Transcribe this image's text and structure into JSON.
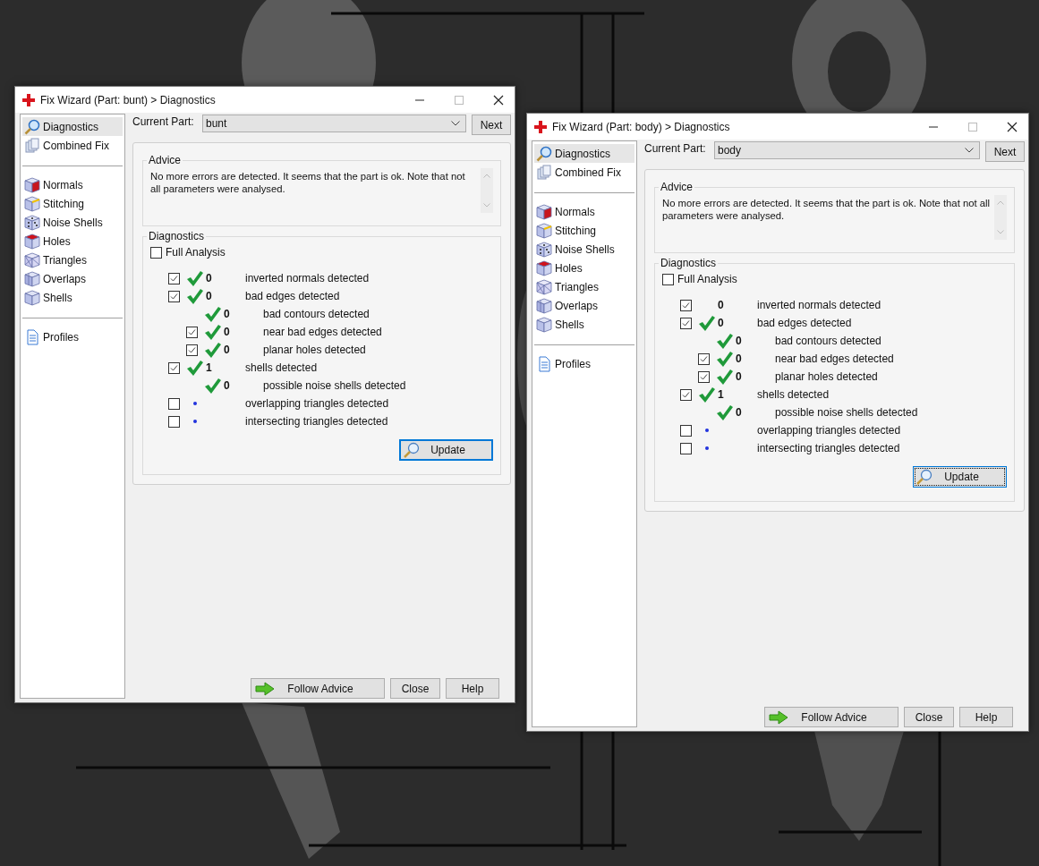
{
  "windows": [
    {
      "title": "Fix Wizard (Part: bunt) > Diagnostics",
      "sidebar": {
        "groups": [
          [
            {
              "label": "Diagnostics",
              "selected": true
            },
            {
              "label": "Combined Fix",
              "selected": false
            }
          ],
          [
            {
              "label": "Normals",
              "selected": false
            },
            {
              "label": "Stitching",
              "selected": false
            },
            {
              "label": "Noise Shells",
              "selected": false
            },
            {
              "label": "Holes",
              "selected": false
            },
            {
              "label": "Triangles",
              "selected": false
            },
            {
              "label": "Overlaps",
              "selected": false
            },
            {
              "label": "Shells",
              "selected": false
            }
          ],
          [
            {
              "label": "Profiles",
              "selected": false
            }
          ]
        ]
      },
      "current_part": {
        "label": "Current Part:",
        "value": "bunt"
      },
      "next_button": "Next",
      "advice": {
        "title": "Advice",
        "text": "No more errors are detected. It seems that the part is ok. Note that not all parameters were analysed."
      },
      "diagnostics": {
        "title": "Diagnostics",
        "full_analysis": {
          "label": "Full Analysis",
          "checked": false
        },
        "rows": [
          {
            "checked": true,
            "kind": "ok",
            "count": "0",
            "label": "inverted normals detected"
          },
          {
            "checked": true,
            "kind": "ok",
            "count": "0",
            "label": "bad edges detected",
            "children": [
              {
                "kind": "ok",
                "count": "0",
                "label": "bad contours detected"
              },
              {
                "checked": true,
                "kind": "ok",
                "count": "0",
                "label": "near bad edges detected"
              },
              {
                "checked": true,
                "kind": "ok",
                "count": "0",
                "label": "planar holes detected"
              }
            ]
          },
          {
            "checked": true,
            "kind": "ok",
            "count": "1",
            "label": "shells detected",
            "children": [
              {
                "kind": "ok",
                "count": "0",
                "label": "possible noise shells detected"
              }
            ]
          },
          {
            "checked": false,
            "kind": "pending",
            "label": "overlapping triangles detected"
          },
          {
            "checked": false,
            "kind": "pending",
            "label": "intersecting triangles detected"
          }
        ],
        "update_button": "Update"
      },
      "buttons": [
        "Follow Advice",
        "Close",
        "Help"
      ]
    },
    {
      "title": "Fix Wizard (Part: body) > Diagnostics",
      "sidebar": {
        "groups": [
          [
            {
              "label": "Diagnostics",
              "selected": true
            },
            {
              "label": "Combined Fix",
              "selected": false
            }
          ],
          [
            {
              "label": "Normals",
              "selected": false
            },
            {
              "label": "Stitching",
              "selected": false
            },
            {
              "label": "Noise Shells",
              "selected": false
            },
            {
              "label": "Holes",
              "selected": false
            },
            {
              "label": "Triangles",
              "selected": false
            },
            {
              "label": "Overlaps",
              "selected": false
            },
            {
              "label": "Shells",
              "selected": false
            }
          ],
          [
            {
              "label": "Profiles",
              "selected": false
            }
          ]
        ]
      },
      "current_part": {
        "label": "Current Part:",
        "value": "body"
      },
      "next_button": "Next",
      "advice": {
        "title": "Advice",
        "text": "No more errors are detected. It seems that the part is ok. Note that not all parameters were analysed."
      },
      "diagnostics": {
        "title": "Diagnostics",
        "full_analysis": {
          "label": "Full Analysis",
          "checked": false
        },
        "rows": [
          {
            "checked": true,
            "kind": "plain",
            "count": "0",
            "label": "inverted normals detected"
          },
          {
            "checked": true,
            "kind": "ok",
            "count": "0",
            "label": "bad edges detected",
            "children": [
              {
                "kind": "ok",
                "count": "0",
                "label": "bad contours detected"
              },
              {
                "checked": true,
                "kind": "ok",
                "count": "0",
                "label": "near bad edges detected"
              },
              {
                "checked": true,
                "kind": "ok",
                "count": "0",
                "label": "planar holes detected"
              }
            ]
          },
          {
            "checked": true,
            "kind": "ok",
            "count": "1",
            "label": "shells detected",
            "children": [
              {
                "kind": "ok",
                "count": "0",
                "label": "possible noise shells detected"
              }
            ]
          },
          {
            "checked": false,
            "kind": "pending",
            "label": "overlapping triangles detected"
          },
          {
            "checked": false,
            "kind": "pending",
            "label": "intersecting triangles detected"
          }
        ],
        "update_button": "Update"
      },
      "buttons": [
        "Follow Advice",
        "Close",
        "Help"
      ]
    }
  ]
}
